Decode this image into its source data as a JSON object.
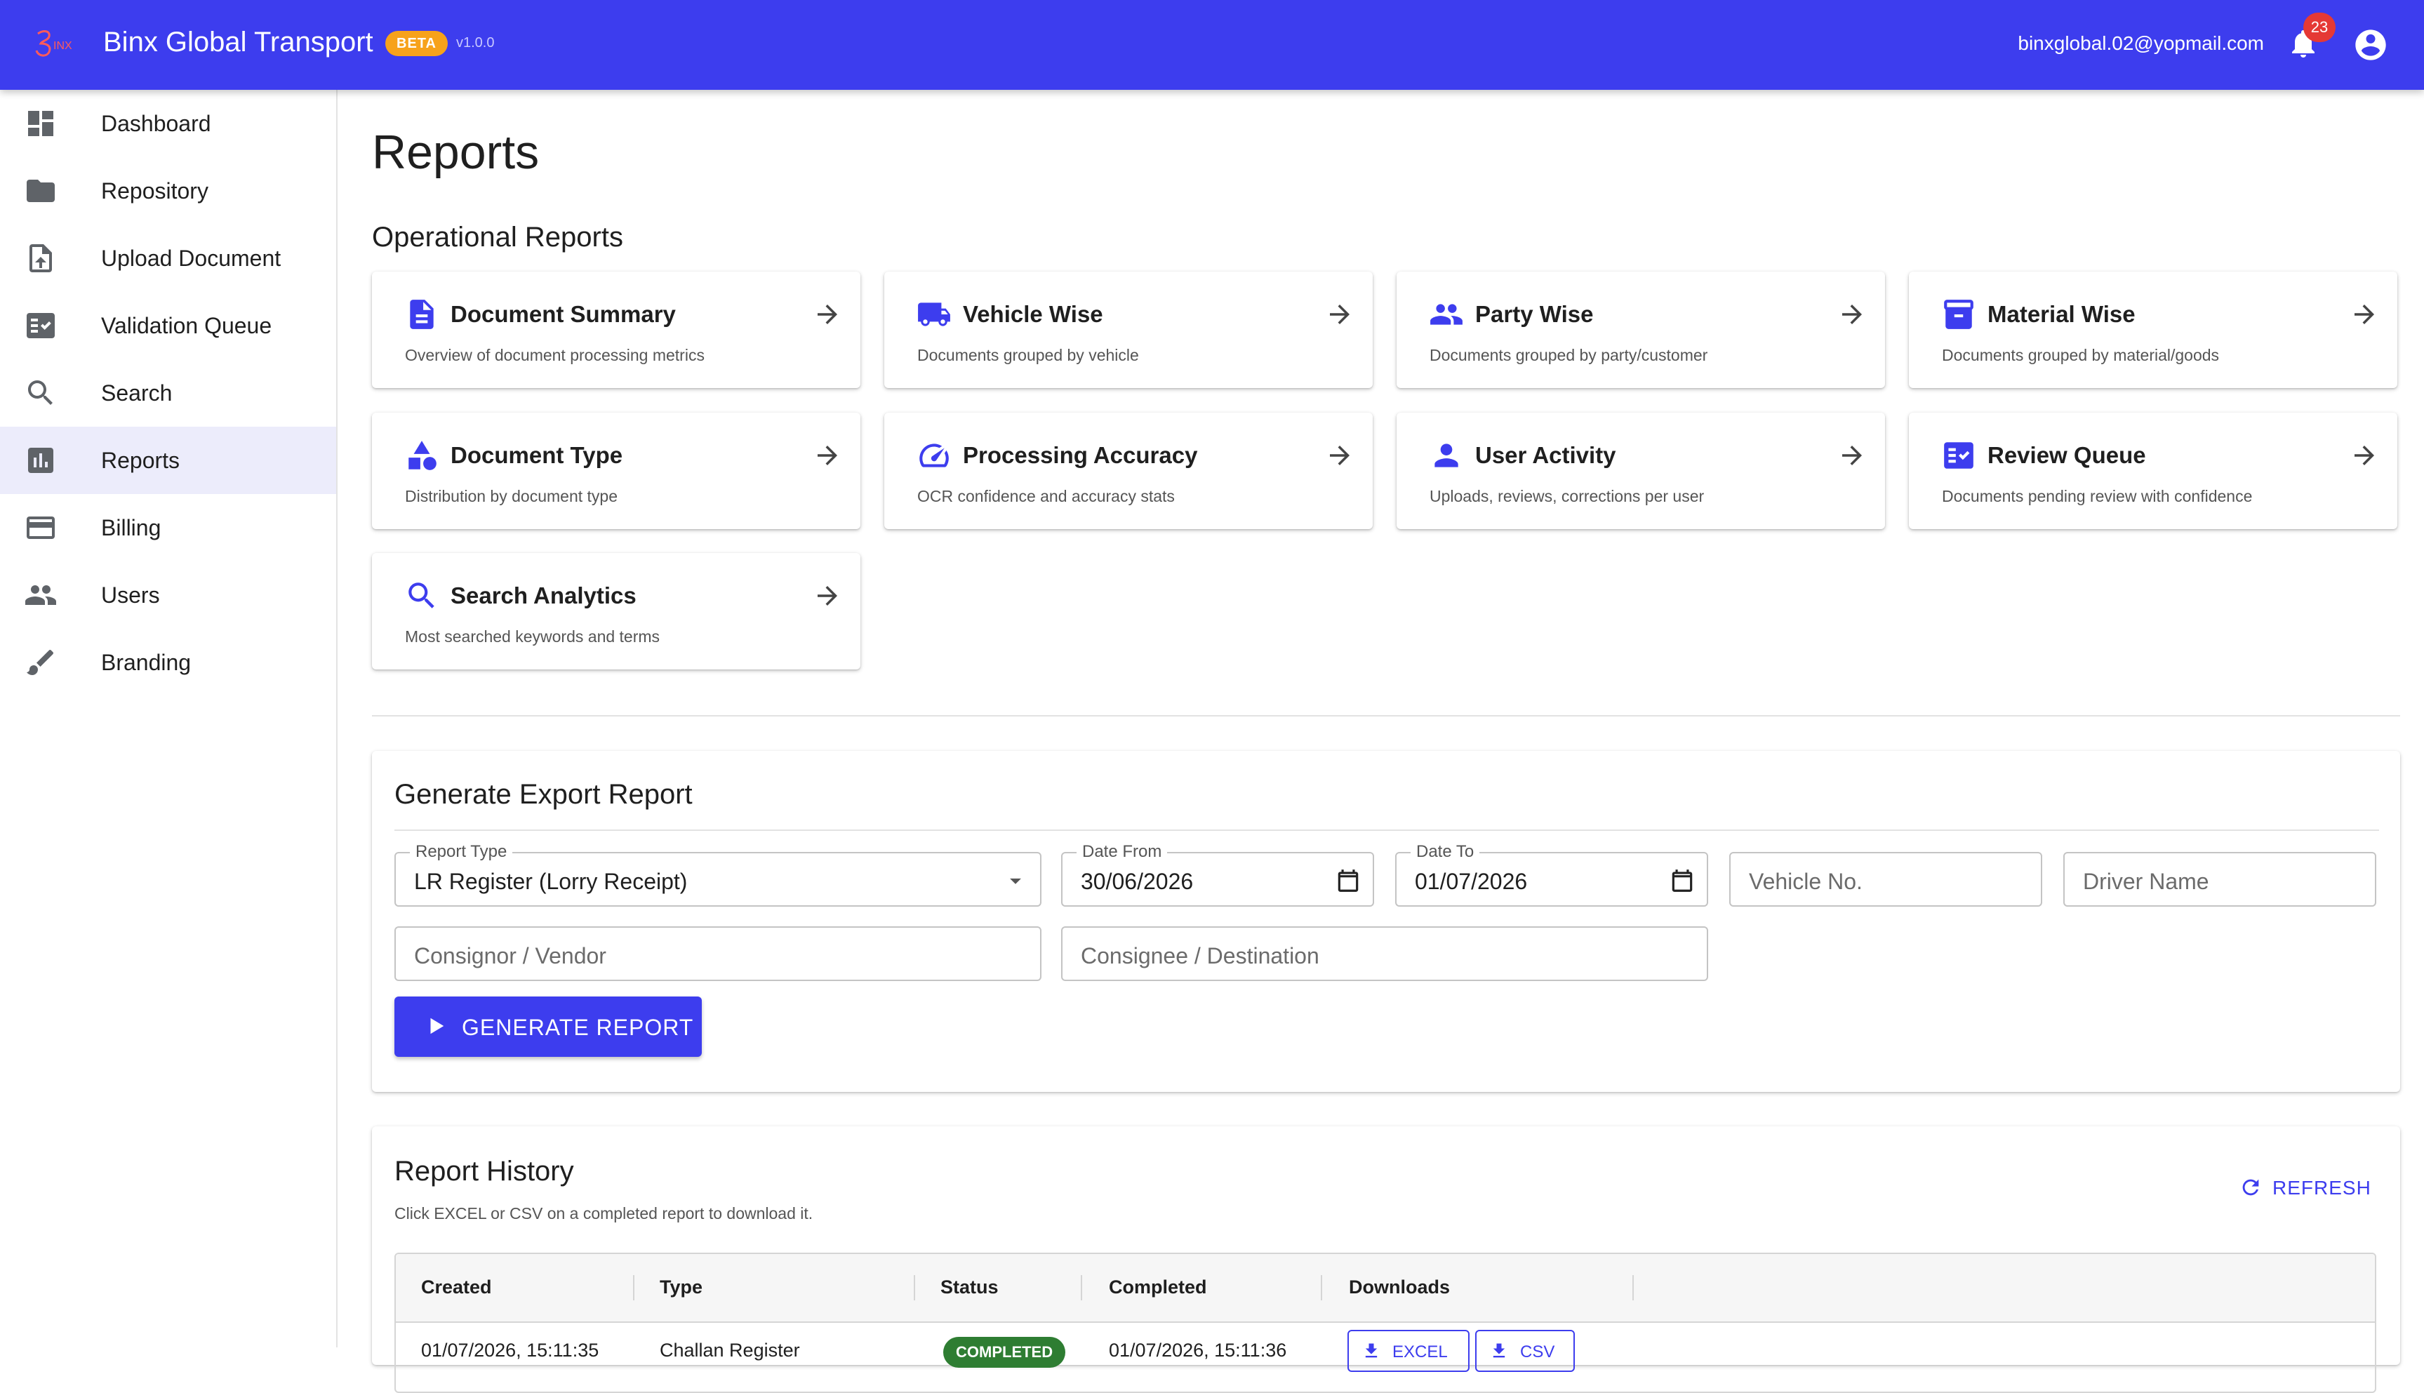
{
  "app": {
    "title": "Binx Global Transport",
    "badge": "BETA",
    "version": "v1.0.0",
    "user_email": "binxglobal.02@yopmail.com",
    "notifications_count": "23",
    "colors": {
      "primary": "#3d3dee",
      "badge": "#f7a21b",
      "notif": "#e53935",
      "success": "#2e7d32"
    }
  },
  "sidebar": {
    "items": [
      {
        "label": "Dashboard",
        "icon": "dashboard-icon"
      },
      {
        "label": "Repository",
        "icon": "folder-icon"
      },
      {
        "label": "Upload Document",
        "icon": "upload-file-icon"
      },
      {
        "label": "Validation Queue",
        "icon": "fact-check-icon"
      },
      {
        "label": "Search",
        "icon": "search-icon"
      },
      {
        "label": "Reports",
        "icon": "bar-chart-icon",
        "active": true
      },
      {
        "label": "Billing",
        "icon": "credit-card-icon"
      },
      {
        "label": "Users",
        "icon": "people-icon"
      },
      {
        "label": "Branding",
        "icon": "brush-icon"
      }
    ]
  },
  "page": {
    "title": "Reports",
    "operational_title": "Operational Reports"
  },
  "cards": [
    {
      "title": "Document Summary",
      "desc": "Overview of document processing metrics",
      "icon": "document-icon"
    },
    {
      "title": "Vehicle Wise",
      "desc": "Documents grouped by vehicle",
      "icon": "truck-icon"
    },
    {
      "title": "Party Wise",
      "desc": "Documents grouped by party/customer",
      "icon": "people-icon"
    },
    {
      "title": "Material Wise",
      "desc": "Documents grouped by material/goods",
      "icon": "inventory-icon"
    },
    {
      "title": "Document Type",
      "desc": "Distribution by document type",
      "icon": "category-icon"
    },
    {
      "title": "Processing Accuracy",
      "desc": "OCR confidence and accuracy stats",
      "icon": "speed-icon"
    },
    {
      "title": "User Activity",
      "desc": "Uploads, reviews, corrections per user",
      "icon": "person-icon"
    },
    {
      "title": "Review Queue",
      "desc": "Documents pending review with confidence",
      "icon": "checklist-icon"
    },
    {
      "title": "Search Analytics",
      "desc": "Most searched keywords and terms",
      "icon": "search-icon"
    }
  ],
  "export": {
    "title": "Generate Export Report",
    "report_type_label": "Report Type",
    "report_type_value": "LR Register (Lorry Receipt)",
    "date_from_label": "Date From",
    "date_from_value": "30/06/2026",
    "date_to_label": "Date To",
    "date_to_value": "01/07/2026",
    "vehicle_placeholder": "Vehicle No.",
    "driver_placeholder": "Driver Name",
    "consignor_placeholder": "Consignor / Vendor",
    "consignee_placeholder": "Consignee / Destination",
    "generate_label": "GENERATE REPORT"
  },
  "history": {
    "title": "Report History",
    "subtitle": "Click EXCEL or CSV on a completed report to download it.",
    "refresh_label": "REFRESH",
    "columns": [
      "Created",
      "Type",
      "Status",
      "Completed",
      "Downloads"
    ],
    "rows": [
      {
        "created": "01/07/2026, 15:11:35",
        "type": "Challan Register",
        "status": "COMPLETED",
        "completed": "01/07/2026, 15:11:36",
        "excel_label": "EXCEL",
        "csv_label": "CSV"
      }
    ]
  }
}
